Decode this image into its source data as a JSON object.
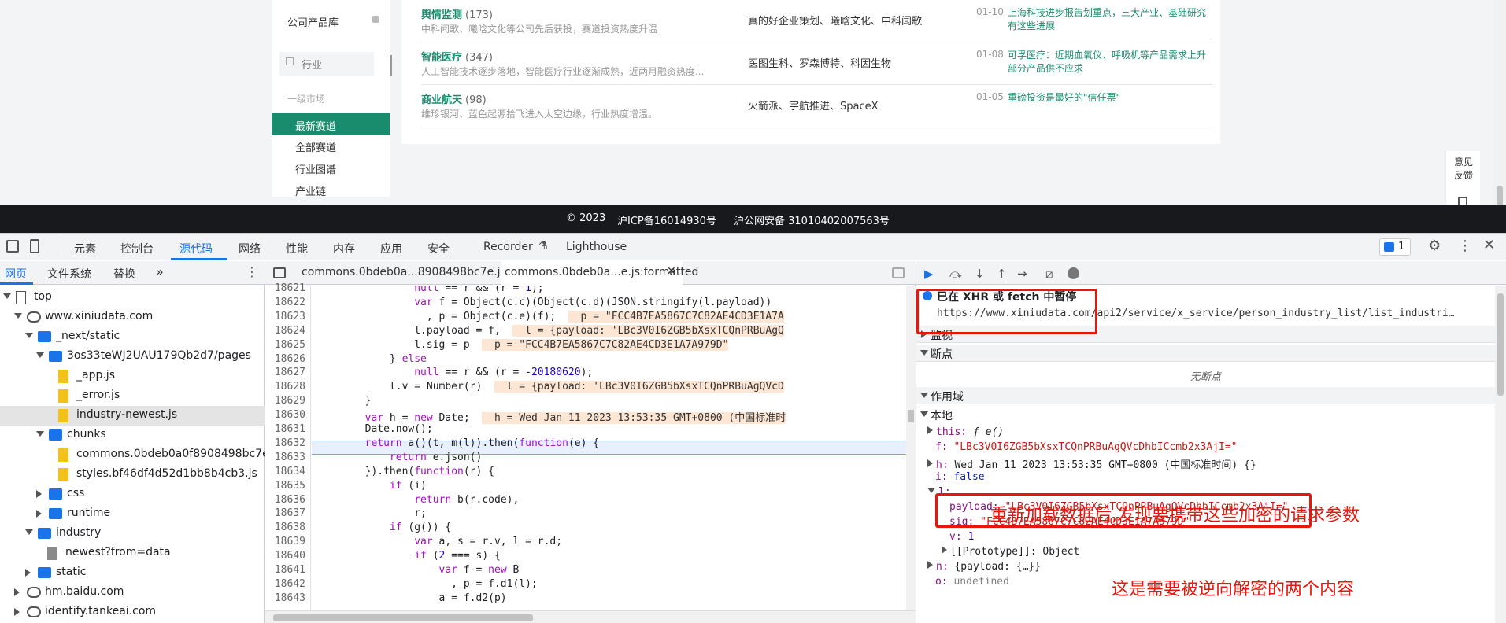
{
  "site": {
    "sidebar": {
      "company_lib": "公司产品库",
      "industry": "行业",
      "primary_market": "一级市场",
      "newest_track": "最新赛道",
      "all_tracks": "全部赛道",
      "industry_map": "行业图谱",
      "industry_chain": "产业链"
    },
    "rows": [
      {
        "name": "舆情监测",
        "count": "(173)",
        "desc": "中科闻歌、曦晗文化等公司先后获投，赛道投资热度升温",
        "companies": "真的好企业策划、曦晗文化、中科闻歌",
        "date": "01-10",
        "news": "上海科技进步报告划重点，三大产业、基础研究有这些进展"
      },
      {
        "name": "智能医疗",
        "count": "(347)",
        "desc": "人工智能技术逐步落地，智能医疗行业逐渐成熟，近两月融资热度...",
        "companies": "医图生科、罗森博特、科因生物",
        "date": "01-08",
        "news": "可孚医疗：近期血氧仪、呼吸机等产品需求上升 部分产品供不应求"
      },
      {
        "name": "商业航天",
        "count": "(98)",
        "desc": "维珍银河、蓝色起源拾飞进入太空边缘，行业热度增温。",
        "companies": "火箭派、宇航推进、SpaceX",
        "date": "01-05",
        "news": "重磅投资是最好的\"信任票\""
      }
    ],
    "footer": {
      "copyright": "© 2023",
      "icp": "沪ICP备16014930号",
      "police": "沪公网安备 31010402007563号"
    },
    "feedback": "意见反馈"
  },
  "devtools": {
    "tabs": [
      "元素",
      "控制台",
      "源代码",
      "网络",
      "性能",
      "内存",
      "应用",
      "安全",
      "Recorder",
      "Lighthouse"
    ],
    "active_tab": "源代码",
    "issues_count": "1",
    "nav_tabs": [
      "网页",
      "文件系统",
      "替换"
    ],
    "tree": [
      {
        "label": "top",
        "depth": 0,
        "kind": "frame",
        "open": true
      },
      {
        "label": "www.xiniudata.com",
        "depth": 1,
        "kind": "cloud",
        "open": true
      },
      {
        "label": "_next/static",
        "depth": 2,
        "kind": "folder",
        "open": true
      },
      {
        "label": "3os33teWJ2UAU179Qb2d7/pages",
        "depth": 3,
        "kind": "folder",
        "open": true
      },
      {
        "label": "_app.js",
        "depth": 4,
        "kind": "file"
      },
      {
        "label": "_error.js",
        "depth": 4,
        "kind": "file"
      },
      {
        "label": "industry-newest.js",
        "depth": 4,
        "kind": "file",
        "selected": true
      },
      {
        "label": "chunks",
        "depth": 3,
        "kind": "folder",
        "open": true
      },
      {
        "label": "commons.0bdeb0a0f8908498bc7e.js",
        "depth": 4,
        "kind": "file"
      },
      {
        "label": "styles.bf46df4d52d1bb8b4cb3.js",
        "depth": 4,
        "kind": "file"
      },
      {
        "label": "css",
        "depth": 3,
        "kind": "folder",
        "open": false
      },
      {
        "label": "runtime",
        "depth": 3,
        "kind": "folder",
        "open": false
      },
      {
        "label": "industry",
        "depth": 2,
        "kind": "folder",
        "open": true
      },
      {
        "label": "newest?from=data",
        "depth": 3,
        "kind": "page"
      },
      {
        "label": "static",
        "depth": 2,
        "kind": "folder",
        "open": false
      },
      {
        "label": "hm.baidu.com",
        "depth": 1,
        "kind": "cloud",
        "open": false
      },
      {
        "label": "identify.tankeai.com",
        "depth": 1,
        "kind": "cloud",
        "open": false
      }
    ],
    "editor_tabs": [
      "commons.0bdeb0a...8908498bc7e.js",
      "commons.0bdeb0a...e.js:formatted"
    ],
    "code_lines": [
      {
        "n": "18621",
        "t": "                null == r && (r = 1);"
      },
      {
        "n": "18622",
        "t": "                var f = Object(c.c)(Object(c.d)(JSON.stringify(l.payload))"
      },
      {
        "n": "18623",
        "t": "                  , p = Object(c.e)(f);",
        "inline": "p = \"FCC4B7EA5867C7C82AE4CD3E1A7A"
      },
      {
        "n": "18624",
        "t": "                l.payload = f,",
        "inline": "l = {payload: 'LBc3V0I6ZGB5bXsxTCQnPRBuAgQ"
      },
      {
        "n": "18625",
        "t": "                l.sig = p",
        "inline": "p = \"FCC4B7EA5867C7C82AE4CD3E1A7A979D\""
      },
      {
        "n": "18626",
        "t": "            } else"
      },
      {
        "n": "18627",
        "t": "                null == r && (r = -20180620);"
      },
      {
        "n": "18628",
        "t": "            l.v = Number(r)",
        "inline": "l = {payload: 'LBc3V0I6ZGB5bXsxTCQnPRBuAgQVcD"
      },
      {
        "n": "18629",
        "t": "        }"
      },
      {
        "n": "18630",
        "t": "        var h = new Date;",
        "inline": "h = Wed Jan 11 2023 13:53:35 GMT+0800 (中国标准时"
      },
      {
        "n": "18631",
        "t": "        Date.now();"
      },
      {
        "n": "18632",
        "t": "        return a()(t, m(l)).then(function(e) {"
      },
      {
        "n": "18633",
        "t": "            return e.json()"
      },
      {
        "n": "18634",
        "t": "        }).then(function(r) {"
      },
      {
        "n": "18635",
        "t": "            if (i)"
      },
      {
        "n": "18636",
        "t": "                return b(r.code),"
      },
      {
        "n": "18637",
        "t": "                r;"
      },
      {
        "n": "18638",
        "t": "            if (g()) {"
      },
      {
        "n": "18639",
        "t": "                var a, s = r.v, l = r.d;"
      },
      {
        "n": "18640",
        "t": "                if (2 === s) {"
      },
      {
        "n": "18641",
        "t": "                    var f = new B"
      },
      {
        "n": "18642",
        "t": "                      , p = f.d1(l);"
      },
      {
        "n": "18643",
        "t": "                    a = f.d2(p)"
      }
    ],
    "debugger": {
      "paused_title": "已在 XHR 或 fetch 中暂停",
      "paused_url": "https://www.xiniudata.com/api2/service/x_service/person_industry_list/list_industri…",
      "watch": "监视",
      "breakpoints": "断点",
      "no_breakpoints": "无断点",
      "scope": "作用域",
      "local": "本地",
      "this_label": "this:",
      "this_val": "ƒ e()",
      "f_key": "f:",
      "f_val": "\"LBc3V0I6ZGB5bXsxTCQnPRBuAgQVcDhbICcmb2x3AjI=\"",
      "h_key": "h:",
      "h_val": "Wed Jan 11 2023 13:53:35 GMT+0800 (中国标准时间) {}",
      "i_key": "i:",
      "i_val": "false",
      "l_key": "l:",
      "payload_key": "payload:",
      "payload_val": "\"LBc3V0I6ZGB5bXsxTCQnPRBuAgQVcDhbICcmb2x3AjI=\"",
      "sig_key": "sig:",
      "sig_val": "\"FCC4B7EA5867C7C82AE4CD3E1A7A979D\"",
      "v_key": "v:",
      "v_val": "1",
      "proto": "[[Prototype]]: Object",
      "n_key": "n:",
      "n_val": "{payload: {…}}",
      "o_key": "o:",
      "o_val": "undefined"
    },
    "annotations": {
      "reload_note": "重新加载数据后,发现要携带这些加密的请求参数",
      "decrypt_note": "这是需要被逆向解密的两个内容"
    }
  }
}
